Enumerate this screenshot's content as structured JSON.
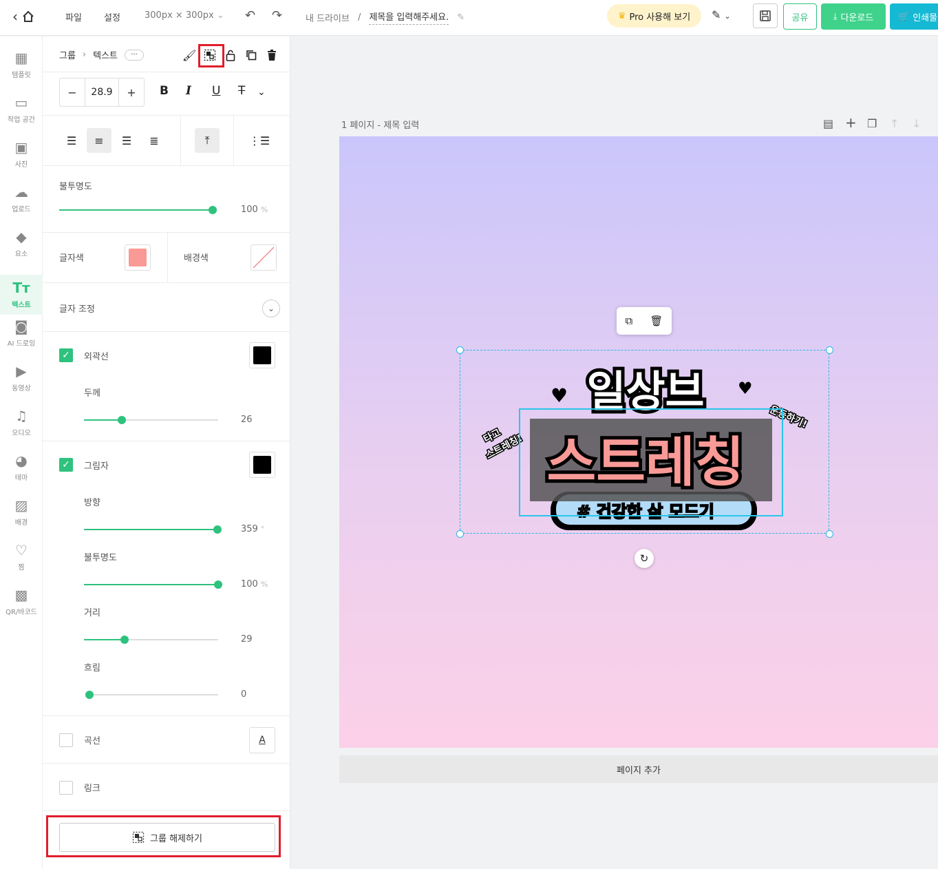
{
  "topbar": {
    "file": "파일",
    "settings": "설정",
    "size": "300px × 300px",
    "breadcrumb_root": "내 드라이브",
    "breadcrumb_sep": "/",
    "title_placeholder": "제목을 입력해주세요.",
    "pro": "Pro 사용해 보기",
    "share": "공유",
    "download": "다운로드",
    "print": "인쇄물"
  },
  "rail": [
    {
      "label": "템플릿",
      "icon": "template-icon"
    },
    {
      "label": "작업 공간",
      "icon": "workspace-icon"
    },
    {
      "label": "사진",
      "icon": "photo-icon"
    },
    {
      "label": "업로드",
      "icon": "upload-icon"
    },
    {
      "label": "요소",
      "icon": "elements-icon"
    },
    {
      "label": "텍스트",
      "icon": "text-icon"
    },
    {
      "label": "AI 드로잉",
      "icon": "ai-drawing-icon"
    },
    {
      "label": "동영상",
      "icon": "video-icon"
    },
    {
      "label": "오디오",
      "icon": "audio-icon"
    },
    {
      "label": "테마",
      "icon": "theme-icon"
    },
    {
      "label": "배경",
      "icon": "background-icon"
    },
    {
      "label": "찜",
      "icon": "heart-icon"
    },
    {
      "label": "QR/바코드",
      "icon": "qr-icon"
    }
  ],
  "panel": {
    "crumb_group": "그룹",
    "crumb_text": "텍스트",
    "crumb_more": "···",
    "font_size": "28.9",
    "opacity_label": "불투명도",
    "opacity_value": "100",
    "opacity_unit": "%",
    "text_color_label": "글자색",
    "text_color": "#f99a96",
    "bg_color_label": "배경색",
    "adjust_label": "글자 조정",
    "outline_label": "외곽선",
    "outline_color": "#000000",
    "thickness_label": "두께",
    "thickness_value": "26",
    "shadow_label": "그림자",
    "shadow_color": "#000000",
    "direction_label": "방향",
    "direction_value": "359",
    "direction_unit": "°",
    "shadow_opacity_label": "불투명도",
    "shadow_opacity_value": "100",
    "shadow_opacity_unit": "%",
    "distance_label": "거리",
    "distance_value": "29",
    "blur_label": "흐림",
    "blur_value": "0",
    "curve_label": "곡선",
    "link_label": "링크",
    "ungroup_label": "그룹 해제하기"
  },
  "slider_levels": {
    "opacity": 1.0,
    "thickness": 0.28,
    "direction": 0.997,
    "shadow_opacity": 1.0,
    "distance": 0.3,
    "blur": 0.0
  },
  "workspace": {
    "page_label": "1 페이지 - 제목 입력",
    "add_page": "페이지 추가"
  },
  "artwork": {
    "line1": "일상브",
    "line2": "스트레칭",
    "line3": "# 건강한 삶 모드기",
    "left_note_1": "타고",
    "left_note_2": "스트레칭!",
    "right_note": "운동하기!"
  },
  "colors": {
    "accent": "#2ec27e",
    "highlight_red": "#e11d2b",
    "selection": "#2ab8e6",
    "download": "#3fd28b",
    "print": "#15b9d3",
    "pro_bg": "#fff3cc"
  }
}
